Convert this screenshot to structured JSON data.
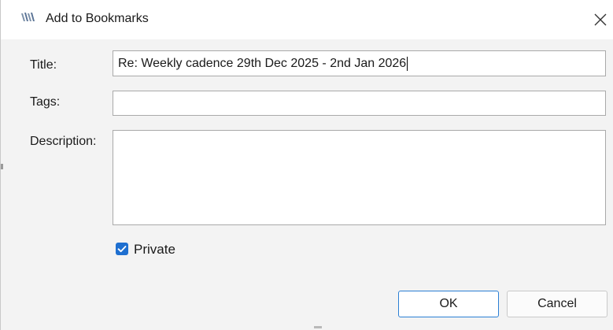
{
  "window": {
    "title": "Add to Bookmarks",
    "app_icon": "app-logo-icon",
    "close_icon": "close-icon"
  },
  "form": {
    "title_label": "Title:",
    "title_value": "Re: Weekly cadence 29th Dec 2025 - 2nd Jan 2026",
    "tags_label": "Tags:",
    "tags_value": "",
    "description_label": "Description:",
    "description_value": "",
    "private_label": "Private",
    "private_checked": true
  },
  "buttons": {
    "ok_label": "OK",
    "cancel_label": "Cancel"
  },
  "colors": {
    "accent": "#1e6fd0",
    "ok_border": "#2b7fd4",
    "background": "#f3f3f3"
  }
}
